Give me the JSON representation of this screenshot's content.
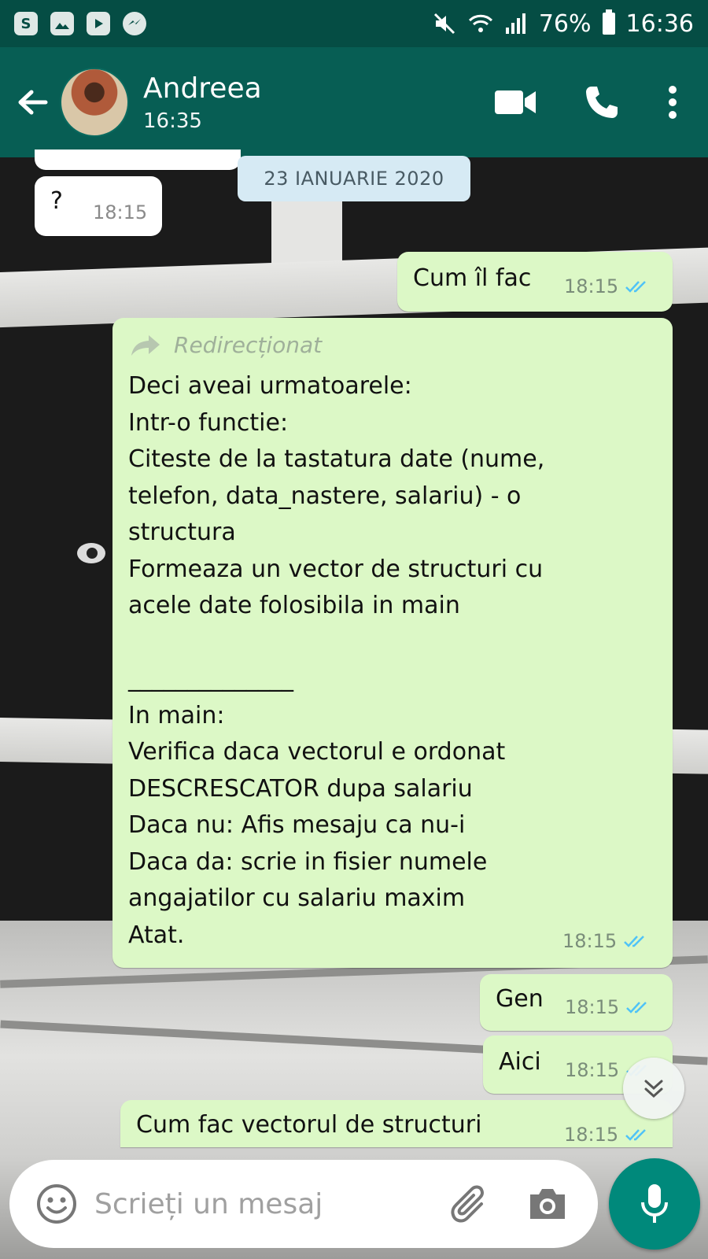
{
  "status_bar": {
    "battery": "76%",
    "time": "16:36",
    "left_icons": [
      "skype-icon",
      "gallery-icon",
      "youtube-icon",
      "messenger-icon"
    ],
    "right_icons": [
      "mute-icon",
      "wifi-icon",
      "signal-icon",
      "battery-icon"
    ]
  },
  "header": {
    "contact_name": "Andreea",
    "last_seen": "16:35",
    "icons": [
      "back-arrow-icon",
      "video-call-icon",
      "phone-icon",
      "more-vert-icon"
    ]
  },
  "chat": {
    "date_divider": "23 IANUARIE 2020",
    "messages": [
      {
        "direction": "in",
        "text": "?",
        "time": "18:15"
      },
      {
        "direction": "out",
        "text": "Cum îl fac",
        "time": "18:15",
        "read": true
      },
      {
        "direction": "out",
        "forwarded_label": "Redirecționat",
        "lines": [
          "Deci aveai urmatoarele:",
          "Intr-o functie:",
          "Citeste de la tastatura date (nume,",
          "telefon, data_nastere, salariu) - o",
          "structura",
          "Formeaza un vector de structuri cu",
          "acele date folosibila in main",
          "",
          "______________",
          "In main:",
          "Verifica daca vectorul e ordonat",
          "DESCRESCATOR dupa salariu",
          "Daca nu: Afis mesaju ca nu-i",
          "Daca da: scrie in fisier numele",
          "angajatilor cu salariu maxim",
          "Atat."
        ],
        "time": "18:15",
        "read": true
      },
      {
        "direction": "out",
        "text": "Gen",
        "time": "18:15",
        "read": true
      },
      {
        "direction": "out",
        "text": "Aici",
        "time": "18:15",
        "read": true
      },
      {
        "direction": "out",
        "text": "Cum fac vectorul de structuri",
        "time": "18:15",
        "read": true
      }
    ]
  },
  "input": {
    "placeholder": "Scrieți un mesaj",
    "icons": [
      "emoji-icon",
      "attach-icon",
      "camera-icon",
      "mic-icon",
      "scroll-down-icon"
    ]
  },
  "colors": {
    "header": "#075e54",
    "status_bar": "#054d44",
    "outgoing_bubble": "#dcf8c6",
    "incoming_bubble": "#ffffff",
    "read_ticks": "#4fc3f7",
    "mic_button": "#00897b"
  }
}
